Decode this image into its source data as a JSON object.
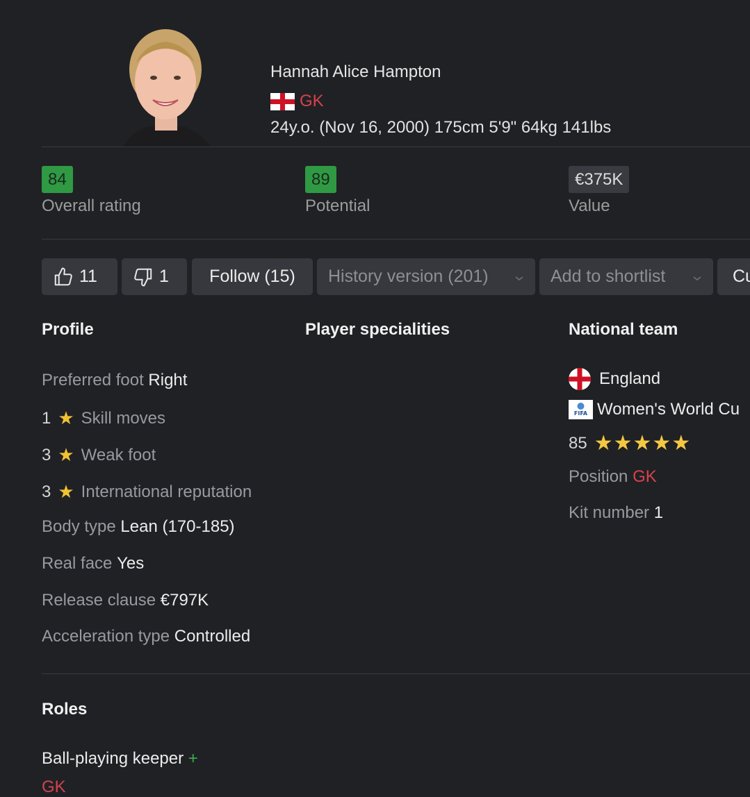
{
  "player": {
    "name": "Hannah Alice Hampton",
    "position": "GK",
    "bio": "24y.o. (Nov 16, 2000) 175cm 5'9\" 64kg 141lbs",
    "flag_icon": "england-flag-icon"
  },
  "stats": {
    "overall": {
      "value": "84",
      "label": "Overall rating"
    },
    "potential": {
      "value": "89",
      "label": "Potential"
    },
    "value": {
      "value": "€375K",
      "label": "Value"
    }
  },
  "actions": {
    "likes": "11",
    "dislikes": "1",
    "follow": "Follow (15)",
    "history": "History version (201)",
    "shortlist": "Add to shortlist",
    "cut_label": "Cu"
  },
  "profile": {
    "title": "Profile",
    "preferred_foot_label": "Preferred foot",
    "preferred_foot": "Right",
    "skill_moves_value": "1",
    "skill_moves_label": "Skill moves",
    "weak_foot_value": "3",
    "weak_foot_label": "Weak foot",
    "intl_rep_value": "3",
    "intl_rep_label": "International reputation",
    "body_type_label": "Body type",
    "body_type": "Lean (170-185)",
    "real_face_label": "Real face",
    "real_face": "Yes",
    "release_clause_label": "Release clause",
    "release_clause": "€797K",
    "accel_label": "Acceleration type",
    "accel": "Controlled"
  },
  "specialities": {
    "title": "Player specialities"
  },
  "national_team": {
    "title": "National team",
    "country": "England",
    "competition": "Women's World Cu",
    "rating": "85",
    "stars": 5,
    "position_label": "Position",
    "position": "GK",
    "kit_label": "Kit number",
    "kit": "1"
  },
  "roles": {
    "title": "Roles",
    "items": [
      {
        "name": "Ball-playing keeper",
        "plus": "+",
        "pos": "GK"
      }
    ]
  },
  "colors": {
    "background": "#202125",
    "accent_green": "#2f9a43",
    "position_red": "#d6434b",
    "star_gold": "#f1c232"
  }
}
